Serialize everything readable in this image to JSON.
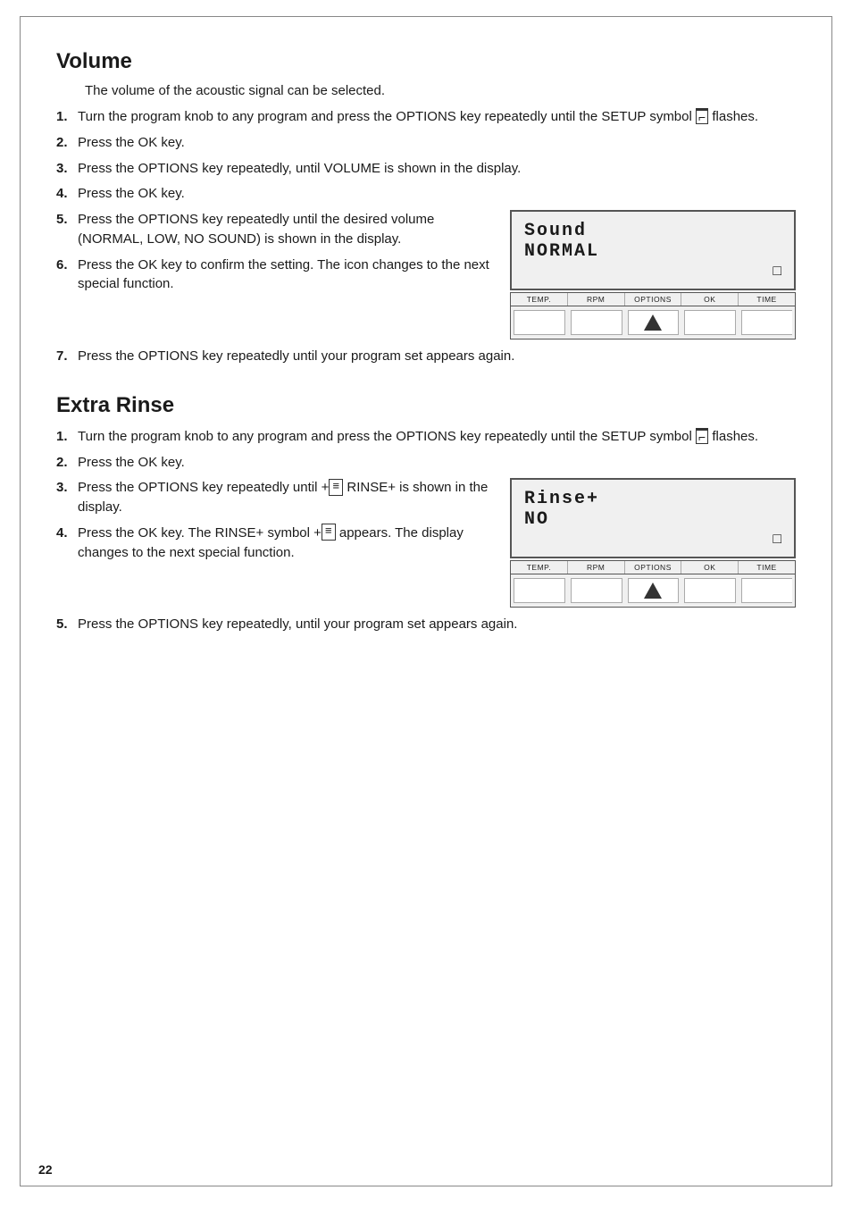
{
  "page": {
    "number": "22",
    "border": true
  },
  "volume_section": {
    "heading": "Volume",
    "intro": "The volume of the acoustic signal can be selected.",
    "steps": [
      {
        "number": "1.",
        "text": "Turn the program knob to any program and press the OPTIONS key repeatedly until the SETUP symbol"
      },
      {
        "number": "2.",
        "text": "Press the OK key."
      },
      {
        "number": "3.",
        "text": "Press the OPTIONS key repeatedly, until VOLUME is shown in the display."
      },
      {
        "number": "4.",
        "text": "Press the OK key."
      },
      {
        "number": "5.",
        "text": "Press the OPTIONS key repeatedly until the desired volume (NORMAL, LOW, NO SOUND) is shown in the display."
      },
      {
        "number": "6.",
        "text": "Press the OK key to confirm the setting. The icon changes to the next special function."
      },
      {
        "number": "7.",
        "text": "Press the OPTIONS key repeatedly until your program set appears again."
      }
    ],
    "display": {
      "line1": "Sound",
      "line2": "NORMAL",
      "setup_icon": "◺"
    },
    "button_row": {
      "labels": [
        "TEMP.",
        "RPM",
        "OPTIONS",
        "OK",
        "TIME"
      ],
      "options_has_arrow": true
    }
  },
  "extra_rinse_section": {
    "heading": "Extra Rinse",
    "steps": [
      {
        "number": "1.",
        "text": "Turn the program knob to any program and press the OPTIONS key repeatedly until the SETUP symbol"
      },
      {
        "number": "2.",
        "text": "Press the OK key."
      },
      {
        "number": "3.",
        "text": "Press the OPTIONS key repeatedly until"
      },
      {
        "number": "4.",
        "text": "Press the OK key. The RINSE+ symbol"
      },
      {
        "number": "5.",
        "text": "Press the OPTIONS key repeatedly, until your program set appears again."
      }
    ],
    "display": {
      "line1": "Rinse+",
      "line2": "NO",
      "setup_icon": "◺"
    },
    "button_row": {
      "labels": [
        "TEMP.",
        "RPM",
        "OPTIONS",
        "OK",
        "TIME"
      ],
      "options_has_arrow": true
    }
  },
  "icons": {
    "setup_symbol": "◺",
    "arrow_up": "▲"
  }
}
